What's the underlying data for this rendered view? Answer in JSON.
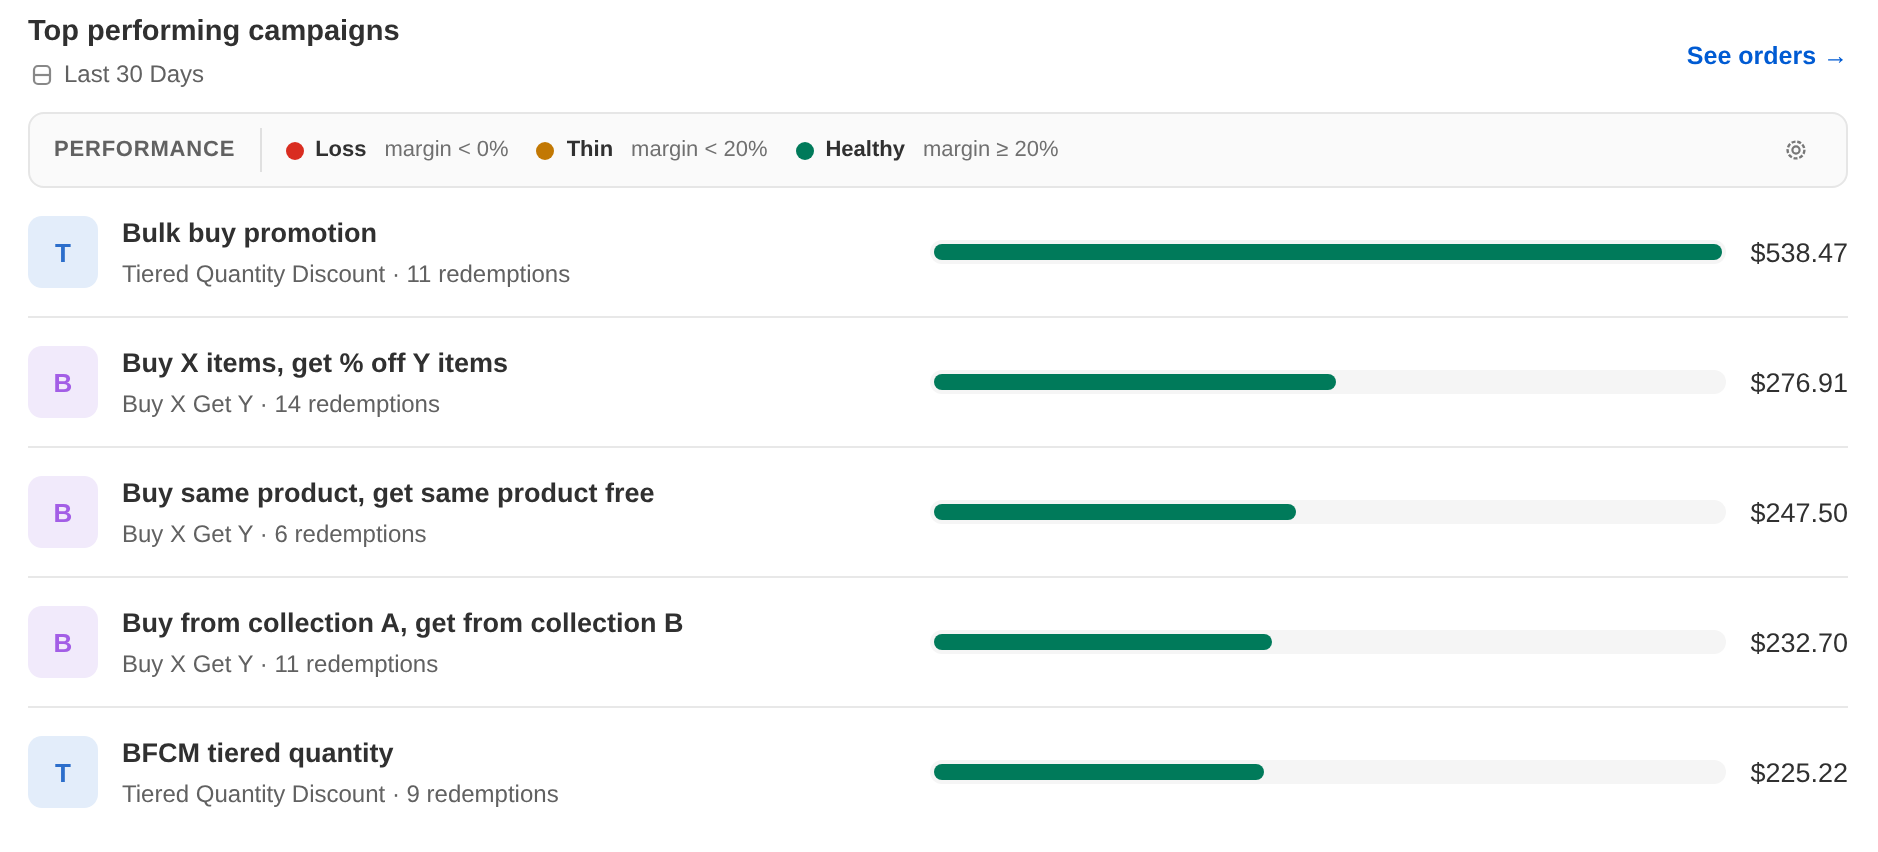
{
  "header": {
    "title": "Top performing campaigns",
    "period": "Last 30 Days",
    "link": "See orders →"
  },
  "legend": {
    "label": "PERFORMANCE",
    "items": [
      {
        "name": "Loss",
        "rule": "margin < 0%",
        "color": "#d92d20"
      },
      {
        "name": "Thin",
        "rule": "margin < 20%",
        "color": "#c27803"
      },
      {
        "name": "Healthy",
        "rule": "margin ≥ 20%",
        "color": "#007a5a"
      }
    ]
  },
  "campaigns": [
    {
      "badge": "T",
      "kind": "tiered",
      "name": "Bulk buy promotion",
      "meta": "Tiered Quantity Discount · 11 redemptions",
      "level": 1,
      "amount": "$538.47"
    },
    {
      "badge": "B",
      "kind": "bxgy",
      "name": "Buy X items, get % off Y items",
      "meta": "Buy X Get Y · 14 redemptions",
      "level": 0.51,
      "amount": "$276.91"
    },
    {
      "badge": "B",
      "kind": "bxgy",
      "name": "Buy same product, get same product free",
      "meta": "Buy X Get Y · 6 redemptions",
      "level": 0.46,
      "amount": "$247.50"
    },
    {
      "badge": "B",
      "kind": "bxgy",
      "name": "Buy from collection A, get from collection B",
      "meta": "Buy X Get Y · 11 redemptions",
      "level": 0.43,
      "amount": "$232.70"
    },
    {
      "badge": "T",
      "kind": "tiered",
      "name": "BFCM tiered quantity",
      "meta": "Tiered Quantity Discount · 9 redemptions",
      "level": 0.42,
      "amount": "$225.22"
    }
  ]
}
